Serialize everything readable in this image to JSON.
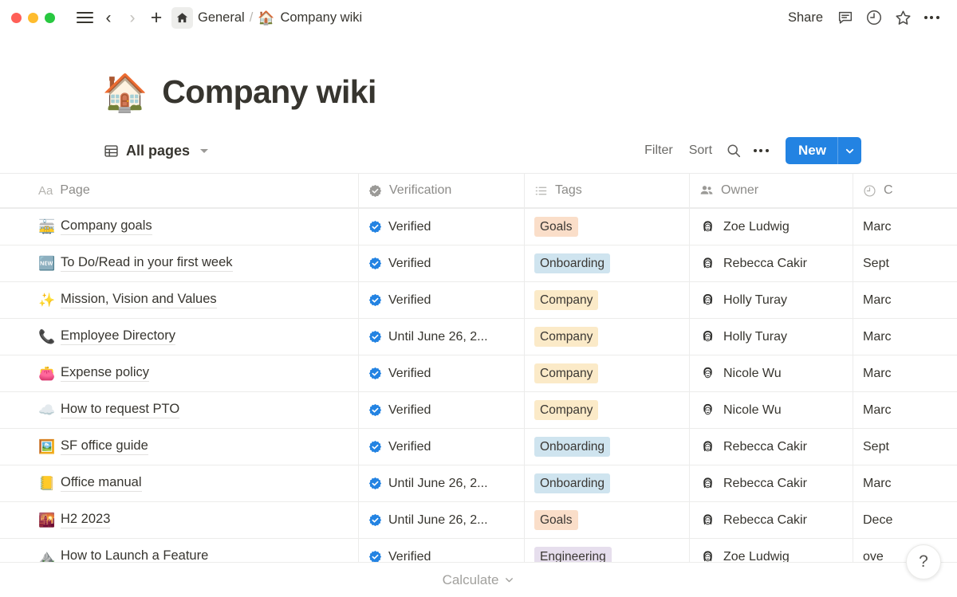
{
  "window": {
    "traffic_lights": [
      "close",
      "minimize",
      "maximize"
    ],
    "colors": {
      "close": "#ff5f57",
      "minimize": "#febc2e",
      "maximize": "#28c840",
      "accent": "#2383e2"
    }
  },
  "topbar": {
    "menu_icon": "hamburger-icon",
    "back_icon": "chevron-left-icon",
    "forward_icon": "chevron-right-icon",
    "new_icon": "plus-icon",
    "home_icon": "home-icon",
    "breadcrumb": {
      "parent": "General",
      "separator": "/",
      "current_emoji": "🏠",
      "current": "Company wiki"
    },
    "share_label": "Share",
    "comment_icon": "comment-icon",
    "history_icon": "clock-icon",
    "favorite_icon": "star-icon",
    "more_icon": "more-horizontal-icon"
  },
  "page": {
    "emoji": "🏠",
    "title": "Company wiki"
  },
  "viewbar": {
    "view_icon": "table-view-icon",
    "view_name": "All pages",
    "filter_label": "Filter",
    "sort_label": "Sort",
    "search_icon": "search-icon",
    "more_icon": "more-horizontal-icon",
    "new_label": "New",
    "new_dropdown_icon": "chevron-down-icon"
  },
  "table": {
    "columns": [
      {
        "label": "Page",
        "icon": "title-text-icon"
      },
      {
        "label": "Verification",
        "icon": "verified-badge-icon"
      },
      {
        "label": "Tags",
        "icon": "multi-select-icon"
      },
      {
        "label": "Owner",
        "icon": "person-icon"
      },
      {
        "label": "C",
        "icon": "clock-icon"
      }
    ],
    "rows": [
      {
        "emoji": "🚋",
        "page": "Company goals",
        "verification": "Verified",
        "tag": "Goals",
        "tag_color": "#fadec9",
        "owner": "Zoe Ludwig",
        "avatar": "woman-long-hair",
        "date": "Marc"
      },
      {
        "emoji": "🆕",
        "page": "To Do/Read in your first week",
        "verification": "Verified",
        "tag": "Onboarding",
        "tag_color": "#cfe4ef",
        "owner": "Rebecca Cakir",
        "avatar": "woman-long-hair",
        "date": "Sept"
      },
      {
        "emoji": "✨",
        "page": "Mission, Vision and Values",
        "verification": "Verified",
        "tag": "Company",
        "tag_color": "#fbeac8",
        "owner": "Holly Turay",
        "avatar": "woman-bob-hair",
        "date": "Marc"
      },
      {
        "emoji": "📞",
        "page": "Employee Directory",
        "verification": "Until June 26, 2...",
        "tag": "Company",
        "tag_color": "#fbeac8",
        "owner": "Holly Turay",
        "avatar": "woman-bob-hair",
        "date": "Marc"
      },
      {
        "emoji": "👛",
        "page": "Expense policy",
        "verification": "Verified",
        "tag": "Company",
        "tag_color": "#fbeac8",
        "owner": "Nicole Wu",
        "avatar": "woman-short-hair",
        "date": "Marc"
      },
      {
        "emoji": "☁️",
        "page": "How to request PTO",
        "verification": "Verified",
        "tag": "Company",
        "tag_color": "#fbeac8",
        "owner": "Nicole Wu",
        "avatar": "woman-short-hair",
        "date": "Marc"
      },
      {
        "emoji": "🖼️",
        "page": "SF office guide",
        "verification": "Verified",
        "tag": "Onboarding",
        "tag_color": "#cfe4ef",
        "owner": "Rebecca Cakir",
        "avatar": "woman-long-hair",
        "date": "Sept"
      },
      {
        "emoji": "📒",
        "page": "Office manual",
        "verification": "Until June 26, 2...",
        "tag": "Onboarding",
        "tag_color": "#cfe4ef",
        "owner": "Rebecca Cakir",
        "avatar": "woman-long-hair",
        "date": "Marc"
      },
      {
        "emoji": "🌇",
        "page": "H2 2023",
        "verification": "Until June 26, 2...",
        "tag": "Goals",
        "tag_color": "#fadec9",
        "owner": "Rebecca Cakir",
        "avatar": "woman-long-hair",
        "date": "Dece"
      },
      {
        "emoji": "⛰️",
        "page": "How to Launch a Feature",
        "verification": "Verified",
        "tag": "Engineering",
        "tag_color": "#e6deed",
        "owner": "Zoe Ludwig",
        "avatar": "woman-long-hair",
        "date": "ove"
      }
    ]
  },
  "footer": {
    "calculate_label": "Calculate",
    "calculate_icon": "chevron-down-icon"
  },
  "help": {
    "label": "?"
  }
}
